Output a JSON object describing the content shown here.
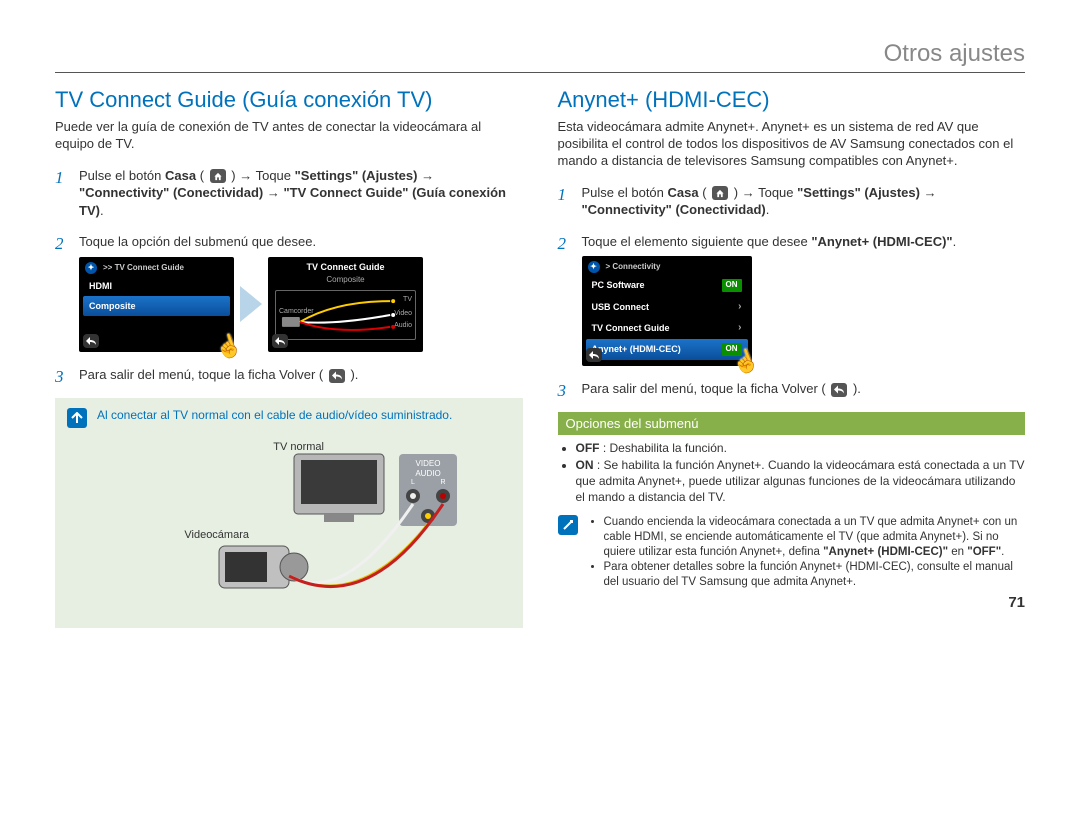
{
  "chapter": "Otros ajustes",
  "page_number": "71",
  "left": {
    "heading": "TV Connect Guide (Guía conexión TV)",
    "intro": "Puede ver la guía de conexión de TV antes de conectar la videocámara al equipo de TV.",
    "step1_a": "Pulse el botón ",
    "step1_casa": "Casa",
    "step1_b": " ( ",
    "step1_c": " ) → Toque ",
    "step1_settings": "\"Settings\" (Ajustes)",
    "step1_d": " → ",
    "step1_conn": "\"Connectivity\" (Conectividad)",
    "step1_e": " → ",
    "step1_tvg": "\"TV Connect Guide\" (Guía conexión TV)",
    "step1_f": ".",
    "step2": "Toque la opción del submenú que desee.",
    "step3_a": "Para salir del menú, toque la ficha Volver ( ",
    "step3_b": " ).",
    "screen1": {
      "crumb": ">> TV Connect Guide",
      "item1": "HDMI",
      "item2": "Composite"
    },
    "screen2": {
      "title": "TV Connect Guide",
      "sub": "Composite",
      "camcorder": "Camcorder",
      "tv": "TV",
      "video": "Video",
      "audio": "Audio"
    },
    "info_text": "Al conectar al TV normal con el cable de audio/vídeo suministrado.",
    "illus_tv": "TV normal",
    "illus_cam": "Videocámara",
    "illus_video": "VIDEO",
    "illus_audio": "AUDIO",
    "illus_l": "L",
    "illus_r": "R"
  },
  "right": {
    "heading": "Anynet+ (HDMI-CEC)",
    "intro": "Esta videocámara admite Anynet+. Anynet+ es un sistema de red AV que posibilita el control de todos los dispositivos de AV Samsung conectados con el mando a distancia de televisores Samsung compatibles con Anynet+.",
    "step1_a": "Pulse el botón ",
    "step1_casa": "Casa",
    "step1_b": " ( ",
    "step1_c": " ) → Toque ",
    "step1_settings": "\"Settings\" (Ajustes)",
    "step1_d": " → ",
    "step1_conn": "\"Connectivity\" (Conectividad)",
    "step1_e": ".",
    "step2_a": "Toque el elemento siguiente que desee ",
    "step2_b": "\"Anynet+ (HDMI-CEC)\"",
    "step2_c": ".",
    "step3_a": "Para salir del menú, toque la ficha Volver ( ",
    "step3_b": " ).",
    "screen": {
      "crumb": "> Connectivity",
      "item1": "PC Software",
      "item2": "USB Connect",
      "item3": "TV Connect Guide",
      "item4": "Anynet+ (HDMI-CEC)",
      "on": "ON"
    },
    "opt_header": "Opciones del submenú",
    "opt_off_label": "OFF",
    "opt_off_text": " : Deshabilita la función.",
    "opt_on_label": "ON",
    "opt_on_text": " : Se habilita la función Anynet+. Cuando la videocámara está conectada a un TV que admita Anynet+, puede utilizar algunas funciones de la videocámara utilizando el mando a distancia del TV.",
    "tip1_a": "Cuando encienda la videocámara conectada a un TV que admita Anynet+ con un cable HDMI, se enciende automáticamente el TV (que admita Anynet+). Si no quiere utilizar esta función Anynet+, defina ",
    "tip1_b": "\"Anynet+ (HDMI-CEC)\"",
    "tip1_c": " en ",
    "tip1_d": "\"OFF\"",
    "tip1_e": ".",
    "tip2": "Para obtener detalles sobre la función Anynet+ (HDMI-CEC), consulte el manual del usuario del TV Samsung que admita Anynet+."
  }
}
